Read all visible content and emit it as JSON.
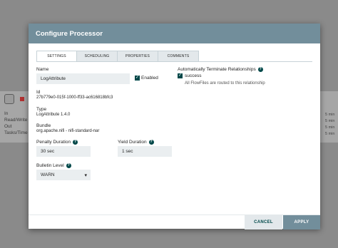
{
  "background": {
    "side_labels": [
      "In",
      "Read/Write",
      "Out",
      "Tasks/Time"
    ],
    "right_labels": [
      "5 min",
      "5 min",
      "5 min",
      "5 min"
    ]
  },
  "dialog": {
    "title": "Configure Processor",
    "tabs": [
      {
        "label": "SETTINGS",
        "active": true
      },
      {
        "label": "SCHEDULING",
        "active": false
      },
      {
        "label": "PROPERTIES",
        "active": false
      },
      {
        "label": "COMMENTS",
        "active": false
      }
    ],
    "name": {
      "label": "Name",
      "value": "LogAttribute"
    },
    "enabled": {
      "label": "Enabled",
      "checked": true
    },
    "id": {
      "label": "Id",
      "value": "27b779e0-015f-1000-ff33-ac616818bfc3"
    },
    "type": {
      "label": "Type",
      "value": "LogAttribute 1.4.0"
    },
    "bundle": {
      "label": "Bundle",
      "value": "org.apache.nifi - nifi-standard-nar"
    },
    "penalty": {
      "label": "Penalty Duration",
      "value": "30 sec"
    },
    "yield": {
      "label": "Yield Duration",
      "value": "1 sec"
    },
    "bulletin": {
      "label": "Bulletin Level",
      "value": "WARN"
    },
    "auto_terminate": {
      "label": "Automatically Terminate Relationships",
      "relationship": "success",
      "checked": true,
      "description": "All FlowFiles are routed to this relationship"
    },
    "buttons": {
      "cancel": "CANCEL",
      "apply": "APPLY"
    }
  },
  "colors": {
    "header": "#728e9b",
    "accent": "#004849",
    "input_bg": "#eaeef0"
  }
}
